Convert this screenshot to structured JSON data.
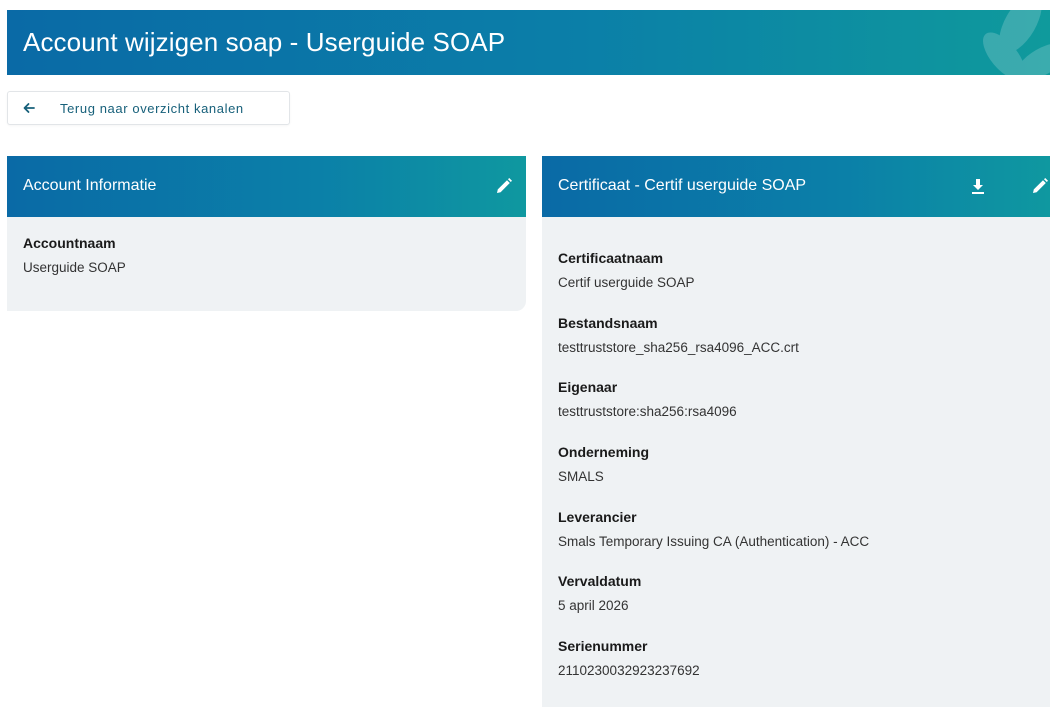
{
  "header": {
    "title": "Account wijzigen soap - Userguide SOAP"
  },
  "back": {
    "label": "Terug naar overzicht kanalen",
    "icon": "arrow-left-icon"
  },
  "account_card": {
    "title": "Account Informatie",
    "edit_icon": "pencil-icon",
    "fields": [
      {
        "label": "Accountnaam",
        "value": "Userguide SOAP"
      }
    ]
  },
  "cert_card": {
    "title": "Certificaat - Certif userguide SOAP",
    "download_icon": "download-icon",
    "edit_icon": "pencil-icon",
    "fields": [
      {
        "label": "Certificaatnaam",
        "value": "Certif userguide SOAP"
      },
      {
        "label": "Bestandsnaam",
        "value": "testtruststore_sha256_rsa4096_ACC.crt"
      },
      {
        "label": "Eigenaar",
        "value": "testtruststore:sha256:rsa4096"
      },
      {
        "label": "Onderneming",
        "value": "SMALS"
      },
      {
        "label": "Leverancier",
        "value": "Smals Temporary Issuing CA (Authentication) - ACC"
      },
      {
        "label": "Vervaldatum",
        "value": "5 april 2026"
      },
      {
        "label": "Serienummer",
        "value": "2110230032923237692"
      }
    ]
  },
  "colors": {
    "header_start": "#0a6aa6",
    "header_end": "#0f9a9c",
    "card_bg": "#eff2f4",
    "link": "#17607a"
  }
}
